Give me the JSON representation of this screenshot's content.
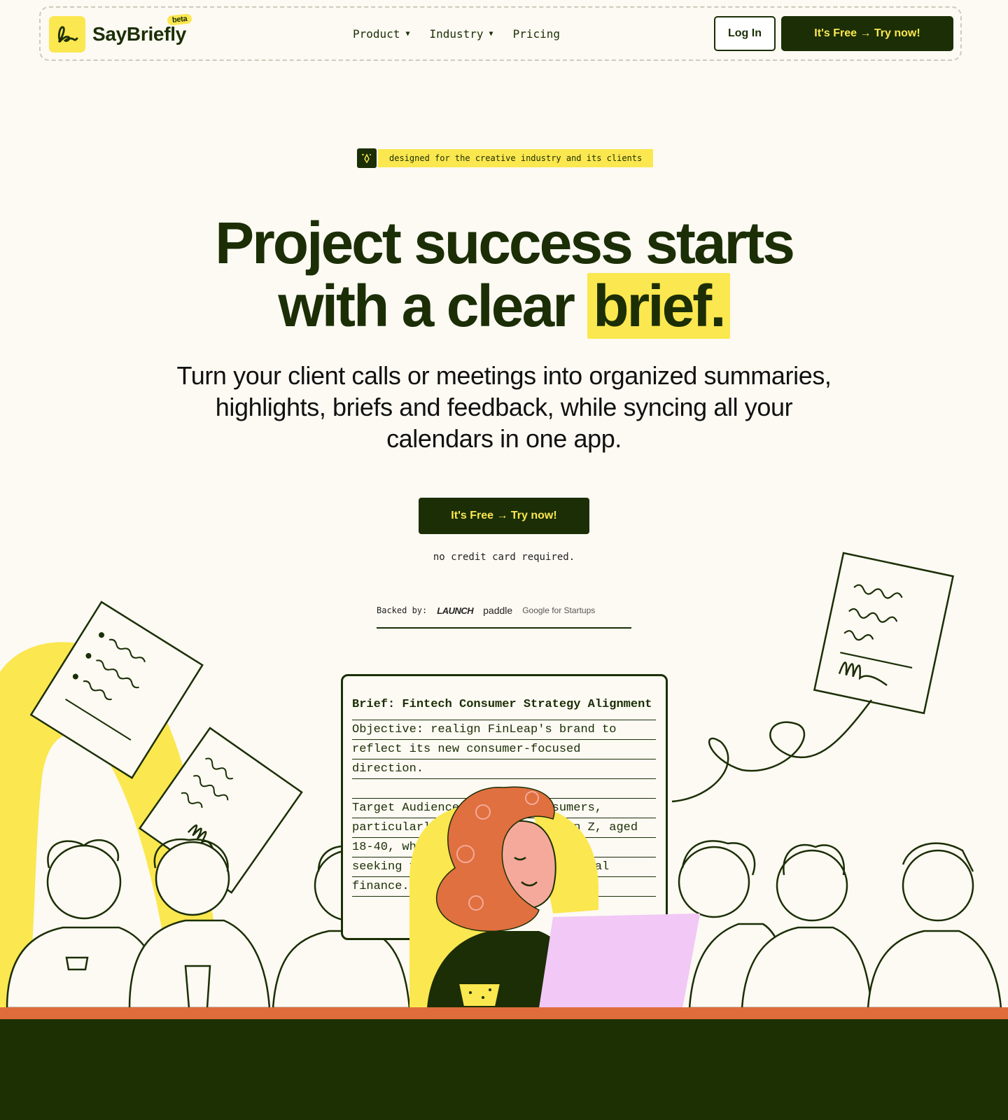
{
  "nav": {
    "brand": "SayBriefly",
    "beta_badge": "beta",
    "links": [
      {
        "label": "Product",
        "has_dropdown": true
      },
      {
        "label": "Industry",
        "has_dropdown": true
      },
      {
        "label": "Pricing",
        "has_dropdown": false
      }
    ],
    "login_label": "Log In",
    "cta_label": "It's Free → Try now!"
  },
  "hero": {
    "tagline": "designed for the creative industry and its clients",
    "headline_line1": "Project success starts",
    "headline_line2_prefix": "with a clear ",
    "headline_highlight": "brief.",
    "subtitle": "Turn your client calls or meetings into organized summaries, highlights, briefs and feedback, while syncing all your calendars in one app.",
    "cta_label": "It's Free → Try now!",
    "note": "no credit card required."
  },
  "backers": {
    "label": "Backed by:",
    "items": [
      "LAUNCH",
      "paddle",
      "Google for Startups"
    ]
  },
  "brief": {
    "title": "Brief: Fintech Consumer Strategy Alignment",
    "lines": [
      "Objective:  realign FinLeap's brand to",
      "reflect its new consumer-focused",
      "direction.",
      "",
      "Target Audience:  Digital consumers,",
      "particularly millennials and Gen Z, aged",
      "18-40, who value transparency and",
      "seeking financial tools for personal",
      "finance."
    ]
  },
  "colors": {
    "accent_yellow": "#fbe74f",
    "dark_green": "#1b2e05",
    "background": "#fcfaf3",
    "floor_orange": "#e06c3c",
    "laptop_pink": "#f1c8f6",
    "hair_orange": "#e0703f"
  },
  "icons": {
    "logo": "signature-logo-icon",
    "pill": "sparkle-pen-icon",
    "dropdown": "caret-down-icon"
  }
}
